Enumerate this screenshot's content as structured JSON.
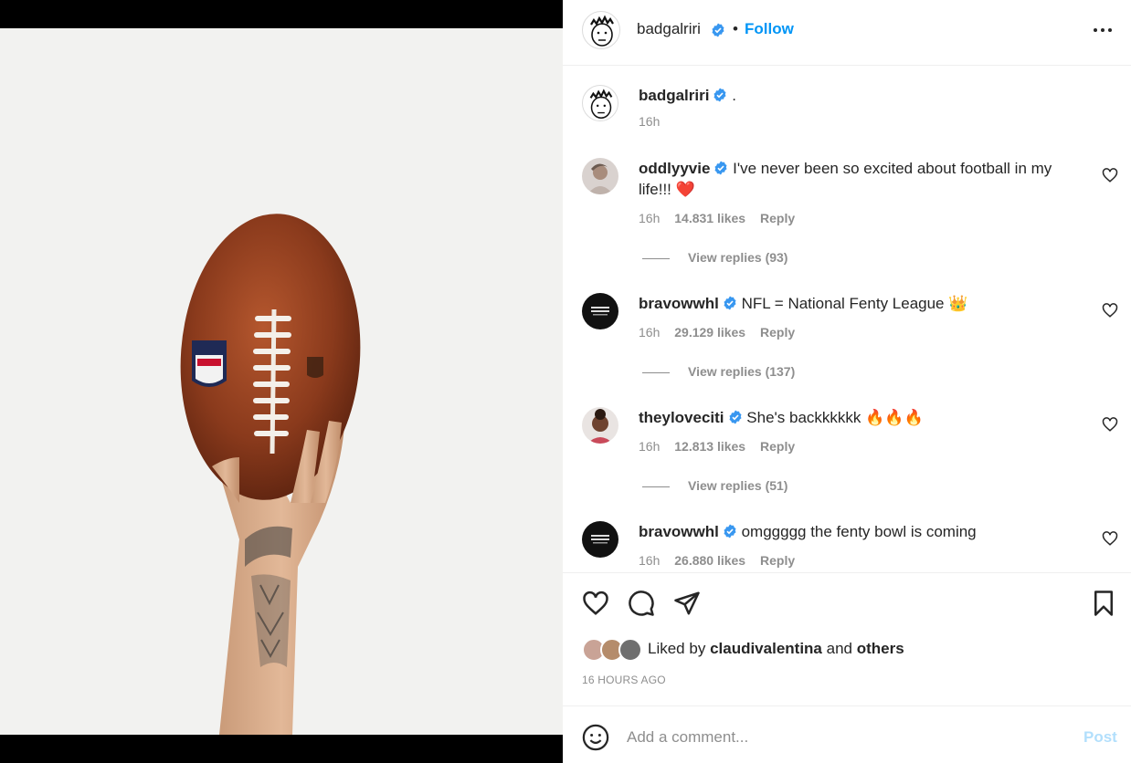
{
  "header": {
    "username": "badgalriri",
    "separator": "•",
    "follow_label": "Follow"
  },
  "caption": {
    "username": "badgalriri",
    "text": ".",
    "time": "16h"
  },
  "comments": [
    {
      "username": "oddlyyvie",
      "text": "I've never been so excited about football in my life!!! ❤️",
      "time": "16h",
      "likes": "14.831 likes",
      "reply": "Reply",
      "view_replies": "View replies (93)"
    },
    {
      "username": "bravowwhl",
      "text": "NFL = National Fenty League 👑",
      "time": "16h",
      "likes": "29.129 likes",
      "reply": "Reply",
      "view_replies": "View replies (137)"
    },
    {
      "username": "theylovecit i",
      "text": "She's backkkkkk 🔥🔥🔥",
      "time": "16h",
      "likes": "12.813 likes",
      "reply": "Reply",
      "view_replies": "View replies (51)"
    },
    {
      "username": "bravowwhl",
      "text": "omggggg the fenty bowl is coming",
      "time": "16h",
      "likes": "26.880 likes",
      "reply": "Reply"
    }
  ],
  "likes_line": {
    "prefix": "Liked by",
    "user": "claudivalentina",
    "and": "and",
    "others": "others"
  },
  "timestamp": "16 HOURS AGO",
  "add_comment": {
    "placeholder": "Add a comment...",
    "post_label": "Post"
  },
  "colors": {
    "accent": "#0095f6",
    "post_disabled": "#b2dffc",
    "verified": "#3897f0",
    "muted": "#8e8e8e"
  }
}
